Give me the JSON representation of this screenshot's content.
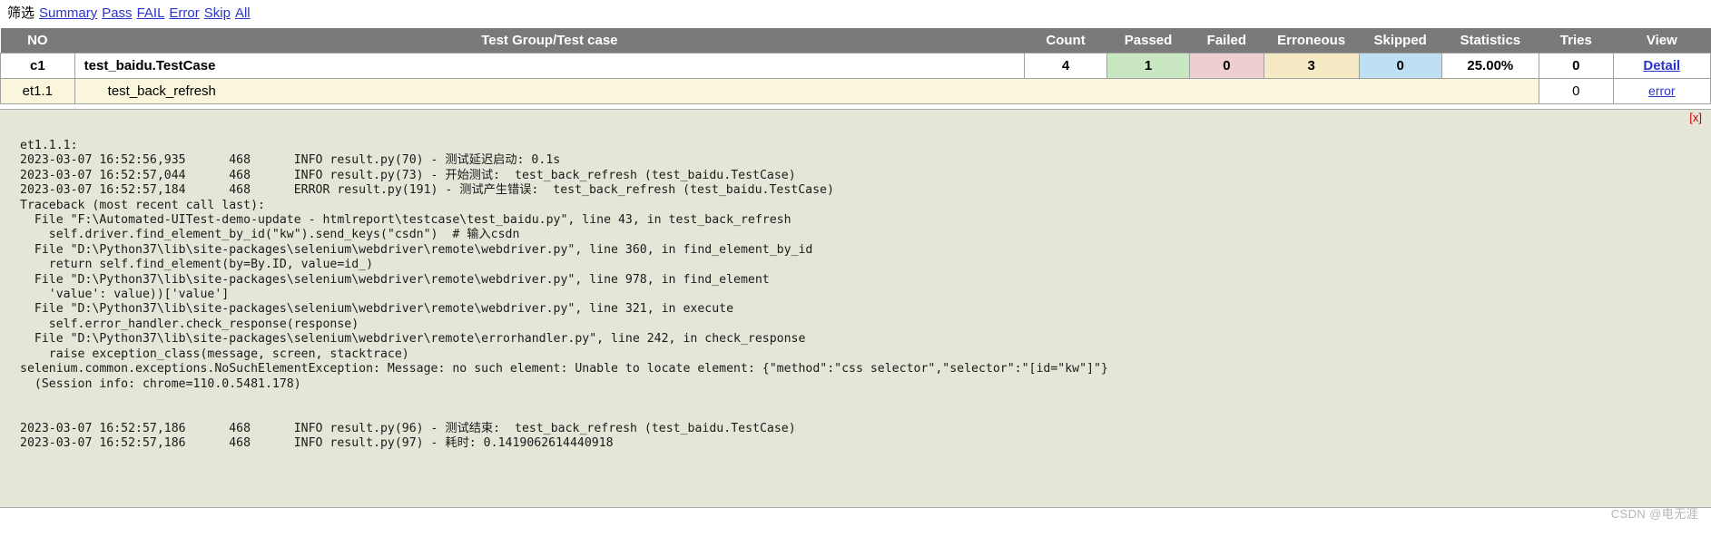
{
  "filter": {
    "label": "筛选",
    "links": [
      "Summary",
      "Pass",
      "FAIL",
      "Error",
      "Skip",
      "All"
    ]
  },
  "table": {
    "headers": {
      "no": "NO",
      "name": "Test Group/Test case",
      "count": "Count",
      "passed": "Passed",
      "failed": "Failed",
      "erroneous": "Erroneous",
      "skipped": "Skipped",
      "statistics": "Statistics",
      "tries": "Tries",
      "view": "View"
    },
    "rows": [
      {
        "type": "group",
        "no": "c1",
        "name": "test_baidu.TestCase",
        "count": "4",
        "passed": "1",
        "failed": "0",
        "erroneous": "3",
        "skipped": "0",
        "statistics": "25.00%",
        "tries": "0",
        "view": "Detail"
      },
      {
        "type": "case",
        "no": "et1.1",
        "name": "test_back_refresh",
        "tries": "0",
        "view": "error"
      }
    ]
  },
  "log_panel": {
    "close_label": "[x]",
    "content": "et1.1.1:\n2023-03-07 16:52:56,935      468      INFO result.py(70) - 测试延迟启动: 0.1s\n2023-03-07 16:52:57,044      468      INFO result.py(73) - 开始测试:  test_back_refresh (test_baidu.TestCase)\n2023-03-07 16:52:57,184      468      ERROR result.py(191) - 测试产生错误:  test_back_refresh (test_baidu.TestCase)\nTraceback (most recent call last):\n  File \"F:\\Automated-UITest-demo-update - htmlreport\\testcase\\test_baidu.py\", line 43, in test_back_refresh\n    self.driver.find_element_by_id(\"kw\").send_keys(\"csdn\")  # 输入csdn\n  File \"D:\\Python37\\lib\\site-packages\\selenium\\webdriver\\remote\\webdriver.py\", line 360, in find_element_by_id\n    return self.find_element(by=By.ID, value=id_)\n  File \"D:\\Python37\\lib\\site-packages\\selenium\\webdriver\\remote\\webdriver.py\", line 978, in find_element\n    'value': value))['value']\n  File \"D:\\Python37\\lib\\site-packages\\selenium\\webdriver\\remote\\webdriver.py\", line 321, in execute\n    self.error_handler.check_response(response)\n  File \"D:\\Python37\\lib\\site-packages\\selenium\\webdriver\\remote\\errorhandler.py\", line 242, in check_response\n    raise exception_class(message, screen, stacktrace)\nselenium.common.exceptions.NoSuchElementException: Message: no such element: Unable to locate element: {\"method\":\"css selector\",\"selector\":\"[id=\"kw\"]\"}\n  (Session info: chrome=110.0.5481.178)\n\n\n2023-03-07 16:52:57,186      468      INFO result.py(96) - 测试结束:  test_back_refresh (test_baidu.TestCase)\n2023-03-07 16:52:57,186      468      INFO result.py(97) - 耗时: 0.1419062614440918"
  },
  "watermark": "CSDN @电无涯"
}
